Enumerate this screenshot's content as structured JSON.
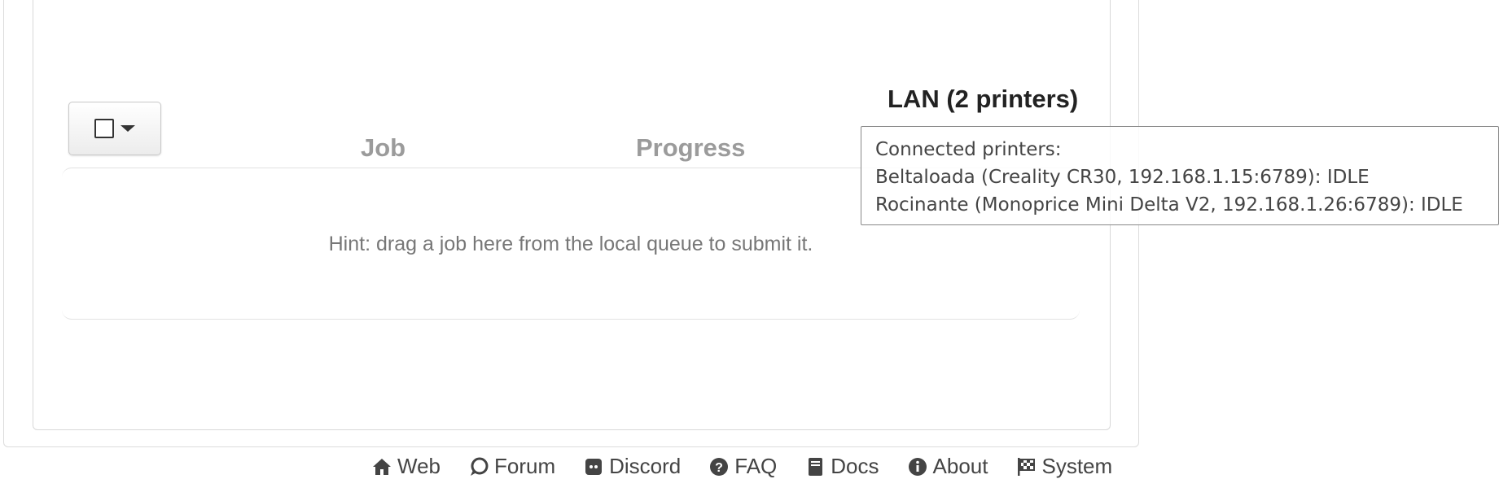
{
  "queue": {
    "title": "LAN (2 printers)",
    "columns": {
      "job": "Job",
      "progress": "Progress"
    },
    "hint": "Hint: drag a job here from the local queue to submit it."
  },
  "tooltip": {
    "heading": "Connected printers:",
    "printers": [
      "Beltaloada (Creality CR30, 192.168.1.15:6789): IDLE",
      "Rocinante (Monoprice Mini Delta V2, 192.168.1.26:6789): IDLE"
    ]
  },
  "footer": {
    "links": [
      {
        "label": "Web",
        "icon": "home-icon"
      },
      {
        "label": "Forum",
        "icon": "comment-icon"
      },
      {
        "label": "Discord",
        "icon": "discord-icon"
      },
      {
        "label": "FAQ",
        "icon": "question-icon"
      },
      {
        "label": "Docs",
        "icon": "book-icon"
      },
      {
        "label": "About",
        "icon": "info-icon"
      },
      {
        "label": "System",
        "icon": "flag-checkered-icon"
      }
    ]
  }
}
